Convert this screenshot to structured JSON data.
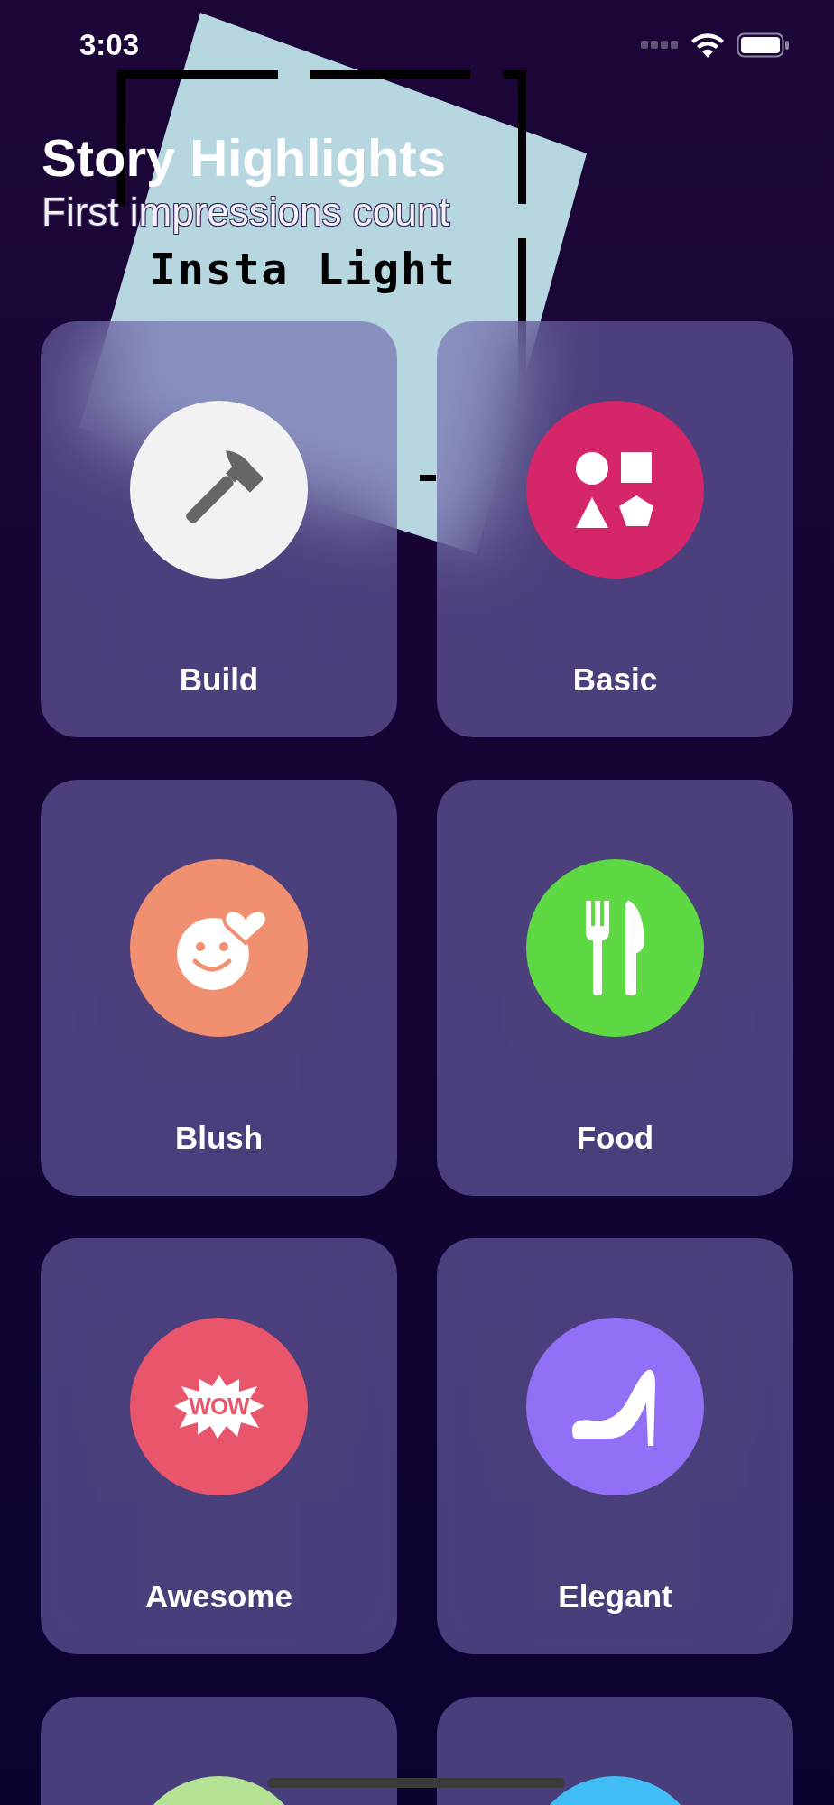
{
  "status_bar": {
    "time": "3:03"
  },
  "logo": {
    "text": "Insta Light"
  },
  "header": {
    "title": "Story Highlights",
    "subtitle": "First impressions count"
  },
  "categories": [
    {
      "label": "Build",
      "kind": "hammer",
      "color": "#f2f2f2"
    },
    {
      "label": "Basic",
      "kind": "shapes",
      "color": "#d6266a"
    },
    {
      "label": "Blush",
      "kind": "smiley",
      "color": "#f19070"
    },
    {
      "label": "Food",
      "kind": "cutlery",
      "color": "#5fd943"
    },
    {
      "label": "Awesome",
      "kind": "wow",
      "color": "#e9566c",
      "badge_text": "WOW"
    },
    {
      "label": "Elegant",
      "kind": "heel",
      "color": "#9270f5"
    },
    {
      "kind": "plain",
      "color": "#b5e395"
    },
    {
      "kind": "plain",
      "color": "#41bdf5"
    }
  ]
}
